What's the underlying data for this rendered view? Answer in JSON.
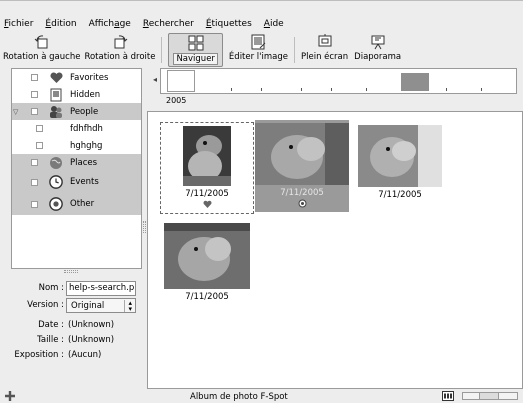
{
  "menubar": {
    "items": [
      {
        "pre": "",
        "ul": "F",
        "post": "ichier"
      },
      {
        "pre": "",
        "ul": "É",
        "post": "dition"
      },
      {
        "pre": "Affich",
        "ul": "a",
        "post": "ge"
      },
      {
        "pre": "",
        "ul": "R",
        "post": "echercher"
      },
      {
        "pre": "",
        "ul": "É",
        "post": "tiquettes"
      },
      {
        "pre": "",
        "ul": "A",
        "post": "ide"
      }
    ]
  },
  "toolbar": {
    "rotate_left": "Rotation à gauche",
    "rotate_right": "Rotation à droite",
    "browse": "Naviguer",
    "edit_image": "Éditer l'image",
    "fullscreen": "Plein écran",
    "slideshow": "Diaporama"
  },
  "tags": [
    {
      "label": "Favorites",
      "icon": "heart-icon",
      "grey": false
    },
    {
      "label": "Hidden",
      "icon": "hidden-icon",
      "grey": false
    },
    {
      "label": "People",
      "icon": "people-icon",
      "grey": true
    },
    {
      "label": "fdhfhdh",
      "icon": "",
      "grey": false
    },
    {
      "label": "hghghg",
      "icon": "",
      "grey": false
    },
    {
      "label": "Places",
      "icon": "globe-icon",
      "grey": true
    },
    {
      "label": "Events",
      "icon": "clock-icon",
      "grey": true
    },
    {
      "label": "Other",
      "icon": "other-icon",
      "grey": true
    }
  ],
  "info": {
    "name_label": "Nom :",
    "name_value": "help-s-search.pn",
    "version_label": "Version :",
    "version_value": "Original",
    "date_label": "Date :",
    "date_value": "(Unknown)",
    "size_label": "Taille :",
    "size_value": "(Unknown)",
    "exposure_label": "Exposition :",
    "exposure_value": "(Aucun)"
  },
  "timeline": {
    "year": "2005",
    "scroll_left": "◂"
  },
  "photos": [
    {
      "date": "7/11/2005",
      "state": "focused",
      "mark": "heart"
    },
    {
      "date": "7/11/2005",
      "state": "selected",
      "mark": "circle"
    },
    {
      "date": "7/11/2005",
      "state": "normal",
      "mark": ""
    },
    {
      "date": "7/11/2005",
      "state": "normal",
      "mark": ""
    }
  ],
  "statusbar": {
    "text": "Album de photo F-Spot"
  },
  "colors": {
    "selection": "#9a9a9a",
    "tag_group": "#c9c9c9",
    "timeline_bar": "#8f8f8f"
  }
}
